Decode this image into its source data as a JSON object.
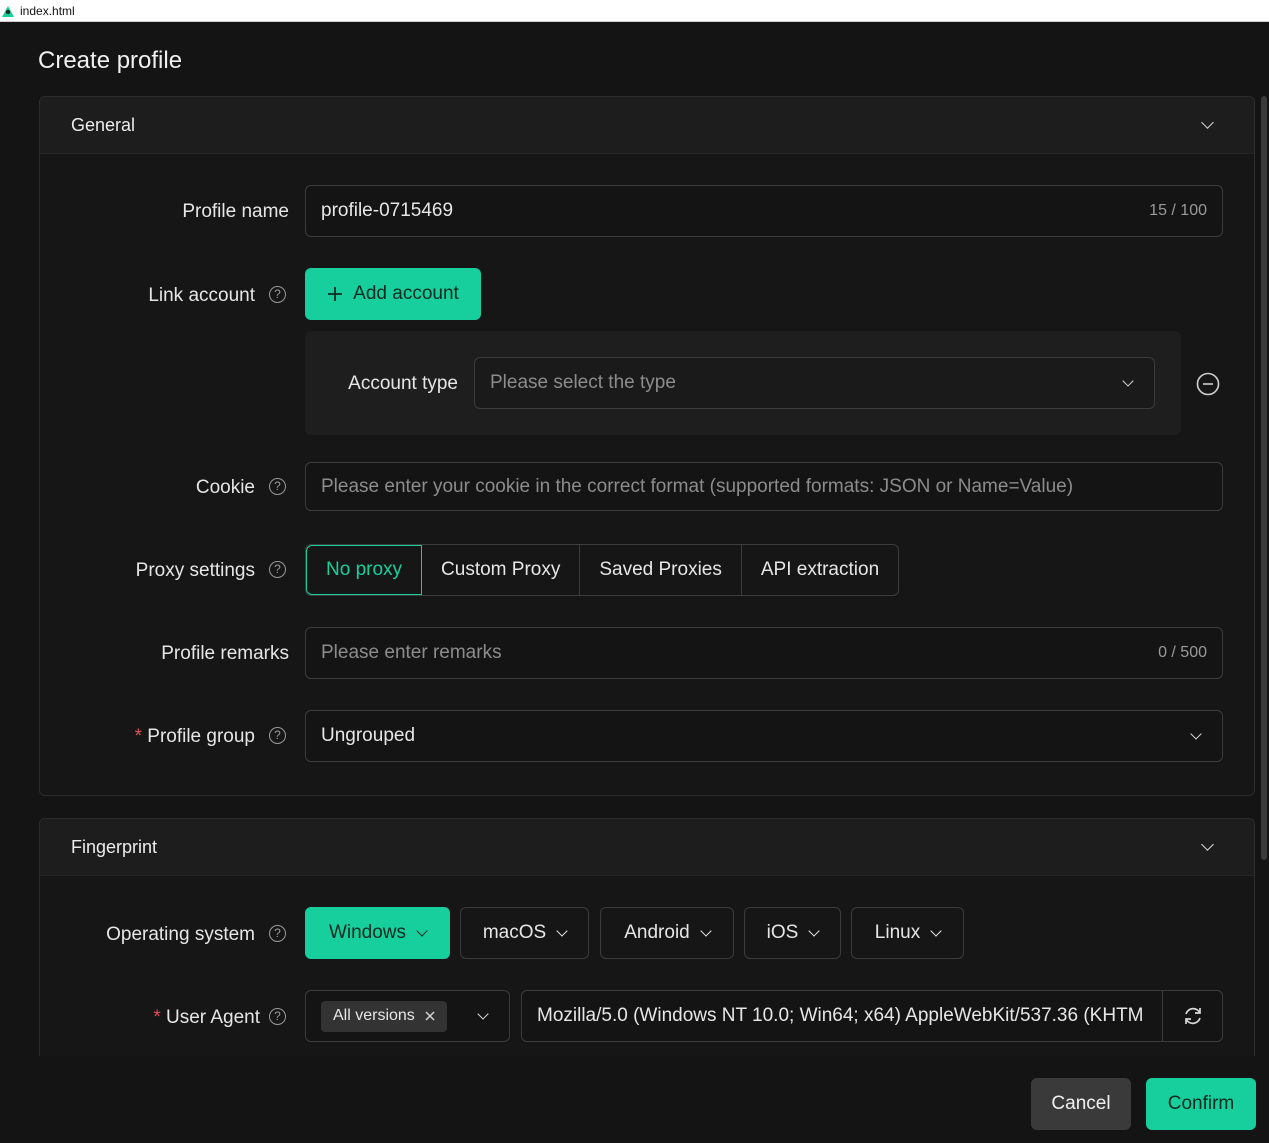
{
  "window": {
    "title": "index.html"
  },
  "dialog": {
    "title": "Create profile"
  },
  "general": {
    "heading": "General",
    "profile_name": {
      "label": "Profile name",
      "value": "profile-0715469",
      "counter": "15 / 100"
    },
    "link_account": {
      "label": "Link account",
      "add_button": "Add account",
      "account_type_label": "Account type",
      "account_type_placeholder": "Please select the type"
    },
    "cookie": {
      "label": "Cookie",
      "placeholder": "Please enter your cookie in the correct format (supported formats: JSON or Name=Value)"
    },
    "proxy": {
      "label": "Proxy settings",
      "options": [
        "No proxy",
        "Custom Proxy",
        "Saved Proxies",
        "API extraction"
      ],
      "selected": "No proxy"
    },
    "remarks": {
      "label": "Profile remarks",
      "placeholder": "Please enter remarks",
      "counter": "0 / 500"
    },
    "group": {
      "label": "Profile group",
      "required_mark": "*",
      "value": "Ungrouped"
    }
  },
  "fingerprint": {
    "heading": "Fingerprint",
    "os": {
      "label": "Operating system",
      "options": [
        "Windows",
        "macOS",
        "Android",
        "iOS",
        "Linux"
      ],
      "selected": "Windows"
    },
    "user_agent": {
      "label": "User Agent",
      "required_mark": "*",
      "version_tag": "All versions",
      "value": "Mozilla/5.0 (Windows NT 10.0; Win64; x64) AppleWebKit/537.36 (KHTM"
    }
  },
  "footer": {
    "cancel": "Cancel",
    "confirm": "Confirm"
  },
  "colors": {
    "accent": "#17cf9c",
    "background": "#141414",
    "required": "#e34d59"
  },
  "icons": [
    "app-icon",
    "chevron-down-icon",
    "help-icon",
    "plus-icon",
    "remove-circle-icon",
    "close-icon",
    "refresh-icon"
  ]
}
